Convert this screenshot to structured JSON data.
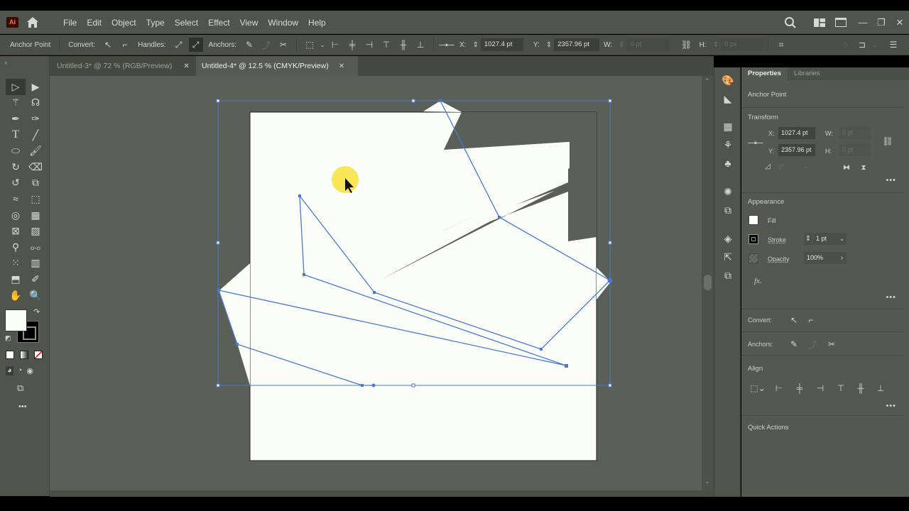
{
  "app": {
    "logo": "Ai",
    "menu": [
      "File",
      "Edit",
      "Object",
      "Type",
      "Select",
      "Effect",
      "View",
      "Window",
      "Help"
    ],
    "window_controls": {
      "minimize": "—",
      "restore": "❐",
      "close": "✕"
    }
  },
  "control_bar": {
    "context_label": "Anchor Point",
    "convert_label": "Convert:",
    "handles_label": "Handles:",
    "anchors_label": "Anchors:",
    "x_label": "X:",
    "x_value": "1027.4 pt",
    "y_label": "Y:",
    "y_value": "2357.96 pt",
    "w_label": "W:",
    "w_value": "0 pt",
    "h_label": "H:",
    "h_value": "0 px"
  },
  "tabs": [
    {
      "label": "Untitled-3* @ 72 % (RGB/Preview)",
      "active": false
    },
    {
      "label": "Untitled-4* @ 12.5 % (CMYK/Preview)",
      "active": true
    }
  ],
  "properties": {
    "tabs": [
      "Properties",
      "Libraries"
    ],
    "selection_type": "Anchor Point",
    "transform": {
      "title": "Transform",
      "x_label": "X:",
      "x_value": "1027.4 pt",
      "y_label": "Y:",
      "y_value": "2357.96 pt",
      "w_label": "W:",
      "w_value": "0 pt",
      "h_label": "H:",
      "h_value": "0 pt",
      "angle_value": "0°"
    },
    "appearance": {
      "title": "Appearance",
      "fill_label": "Fill",
      "fill_color": "#ffffff",
      "stroke_label": "Stroke",
      "stroke_value": "1 pt",
      "opacity_label": "Opacity",
      "opacity_value": "100%",
      "fx_label": "fx."
    },
    "convert_label": "Convert:",
    "anchors_label": "Anchors:",
    "align_title": "Align",
    "quick_actions_title": "Quick Actions"
  },
  "colors": {
    "selection": "#4a78d4",
    "artboard": "#fbfdf9",
    "canvas_bg": "#5a6058",
    "cursor_highlight": "#f7e23a"
  }
}
